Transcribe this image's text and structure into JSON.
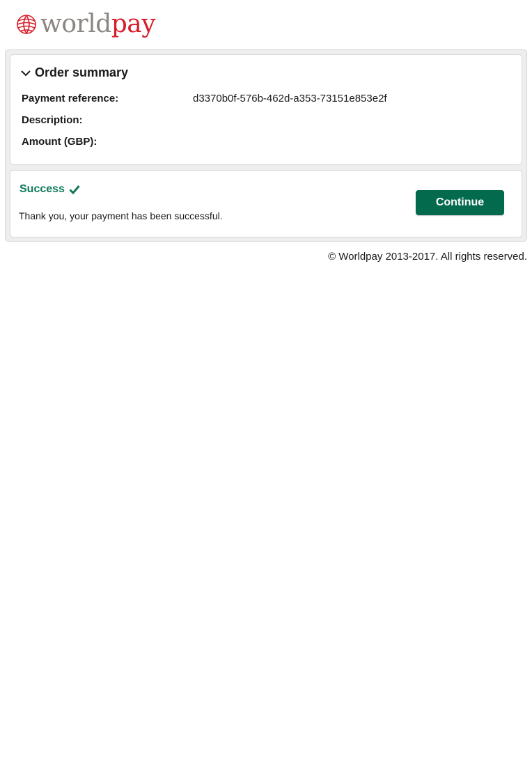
{
  "brand": {
    "logo_part1": "world",
    "logo_part2": "pay",
    "logo_color_grey": "#8c8582",
    "logo_color_red": "#d71e28",
    "logo_icon": "globe-icon"
  },
  "order_summary": {
    "title": "Order summary",
    "toggle_icon": "chevron-down-icon",
    "rows": [
      {
        "label": "Payment reference:",
        "value": "d3370b0f-576b-462d-a353-73151e853e2f"
      },
      {
        "label": "Description:",
        "value": ""
      },
      {
        "label": "Amount (GBP):",
        "value": ""
      }
    ]
  },
  "result": {
    "title": "Success",
    "status_icon": "checkmark-icon",
    "message": "Thank you, your payment has been successful.",
    "continue_label": "Continue",
    "success_color": "#0f7a5a",
    "button_color": "#046a4d"
  },
  "footer": {
    "copyright": "© Worldpay 2013-2017. All rights reserved."
  }
}
